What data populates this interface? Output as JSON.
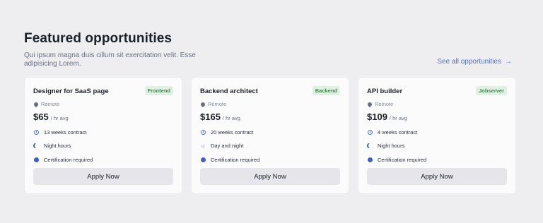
{
  "header": {
    "title": "Featured opportunities",
    "subtitle": "Qui ipsum magna duis cillum sit exercitation velit. Esse adipisicing Lorem.",
    "see_all": "See all opportunities"
  },
  "cards": [
    {
      "role": "Designer for SaaS page",
      "badge": "Frontend",
      "location": "Remote",
      "price": "$65",
      "per": "/ hr avg",
      "features": [
        {
          "icon": "clock",
          "text": "13 weeks contract"
        },
        {
          "icon": "moon",
          "text": "Night hours"
        },
        {
          "icon": "dot",
          "text": "Certification required"
        }
      ],
      "cta": "Apply Now"
    },
    {
      "role": "Backend architect",
      "badge": "Backend",
      "location": "Remote",
      "price": "$165",
      "per": "/ hr avg",
      "features": [
        {
          "icon": "clock",
          "text": "20 weeks contract"
        },
        {
          "icon": "sun",
          "text": "Day and night"
        },
        {
          "icon": "dot",
          "text": "Certification required"
        }
      ],
      "cta": "Apply Now"
    },
    {
      "role": "API builder",
      "badge": "Jobserver",
      "location": "Remote",
      "price": "$109",
      "per": "/ hr avg",
      "features": [
        {
          "icon": "clock",
          "text": "4 weeks contract"
        },
        {
          "icon": "moon",
          "text": "Night hours"
        },
        {
          "icon": "dot",
          "text": "Certification required"
        }
      ],
      "cta": "Apply Now"
    }
  ]
}
